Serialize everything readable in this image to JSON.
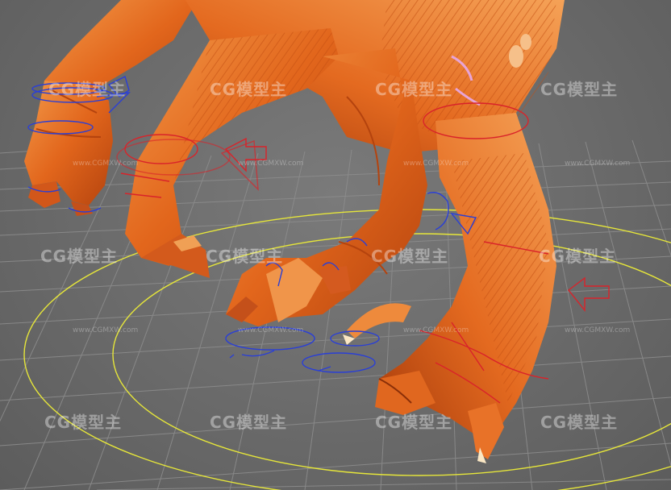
{
  "viewport": {
    "watermark_text": "CG模型主",
    "watermark_url": "www.CGMXW.com"
  },
  "scene": {
    "subject": "orange creature legs and claws",
    "colors": {
      "skin": "#e2661c",
      "skin_dark": "#b4430e",
      "skin_light": "#f39a4a",
      "grid_line": "#8c8c8c",
      "control_circle": "#e6e63a",
      "ik_red": "#d9232a",
      "fk_blue": "#2a3fd6"
    }
  }
}
